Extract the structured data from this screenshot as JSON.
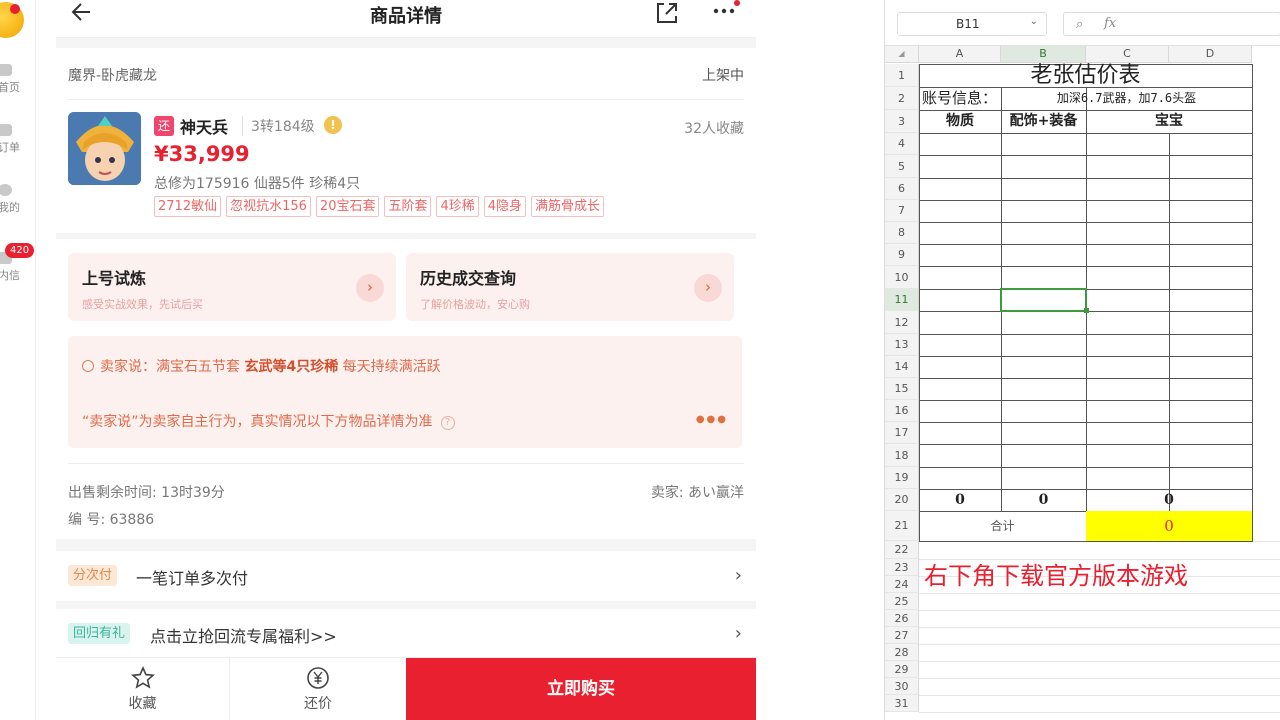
{
  "left_nav": {
    "items": [
      {
        "label": "首页"
      },
      {
        "label": "订单"
      },
      {
        "label": "我的"
      },
      {
        "label": "内信"
      }
    ],
    "badge": "420"
  },
  "product_page": {
    "title": "商品详情",
    "breadcrumb": "魔界-卧虎藏龙",
    "status": "上架中",
    "tag_huan": "还",
    "name": "神天兵",
    "level": "3转184级",
    "favorites": "32人收藏",
    "price": "¥33,999",
    "stats": "总修为175916  仙器5件  珍稀4只",
    "tags": [
      "2712敏仙",
      "忽视抗水156",
      "20宝石套",
      "五阶套",
      "4珍稀",
      "4隐身",
      "满筋骨成长"
    ],
    "features": [
      {
        "title": "上号试炼",
        "subtitle": "感受实战效果，先试后买"
      },
      {
        "title": "历史成交查询",
        "subtitle": "了解价格波动，安心购"
      }
    ],
    "seller_say_prefix": "卖家说：满宝石五节套 ",
    "seller_say_bold": "玄武等4只珍稀",
    "seller_say_suffix": " 每天持续满活跃",
    "disclaimer": "“卖家说”为卖家自主行为，真实情况以下方物品详情为准",
    "remaining_time": "出售剩余时间: 13时39分",
    "seller": "卖家: あい赢洋",
    "serial": "编 号: 63886",
    "installment_tag": "分次付",
    "installment_text": "一笔订单多次付",
    "return_tag": "回归有礼",
    "return_text": "点击立抢回流专属福利>>",
    "bottom": {
      "favorite_label": "收藏",
      "bargain_label": "还价",
      "buy_label": "立即购买"
    }
  },
  "spreadsheet": {
    "namebox": "B11",
    "columns": [
      "A",
      "B",
      "C",
      "D"
    ],
    "rows": [
      "1",
      "2",
      "3",
      "4",
      "5",
      "6",
      "7",
      "8",
      "9",
      "10",
      "11",
      "12",
      "13",
      "14",
      "15",
      "16",
      "17",
      "18",
      "19",
      "20",
      "21",
      "22",
      "23",
      "24",
      "25",
      "26",
      "27",
      "28",
      "29",
      "30",
      "31"
    ],
    "title": "老张估价表",
    "account_label": "账号信息：",
    "account_value": "加深6.7武器，加7.6头盔",
    "headers": [
      "物质",
      "配饰+装备",
      "宝宝"
    ],
    "row20_values": [
      "0",
      "0",
      "0"
    ],
    "total_label": "合计",
    "total_value": "0",
    "promo_text": "右下角下载官方版本游戏",
    "colors": {
      "highlight_yellow": "#ffff00",
      "promo_red": "#e8202f",
      "selection_green": "#3d9a3d"
    }
  }
}
